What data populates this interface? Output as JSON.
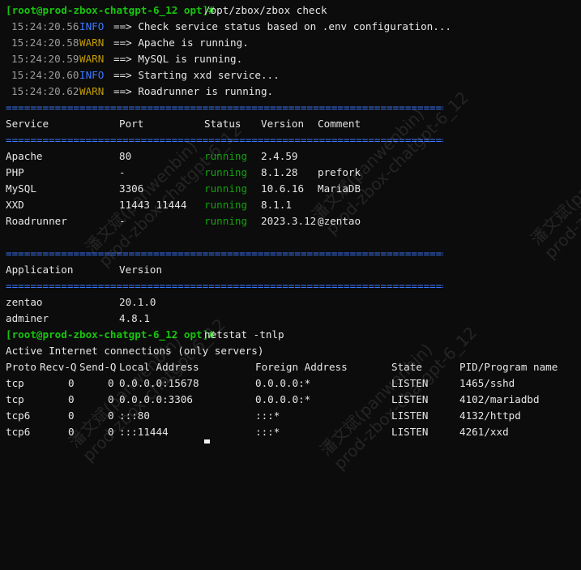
{
  "session1": {
    "prompt": "[root@prod-zbox-chatgpt-6_12 opt]#",
    "command": "/opt/zbox/zbox check"
  },
  "logs": [
    {
      "time": "15:24:20.56",
      "level": "INFO",
      "message": "==> Check service status based on .env configuration..."
    },
    {
      "time": "15:24:20.58",
      "level": "WARN",
      "message": "==> Apache is running."
    },
    {
      "time": "15:24:20.59",
      "level": "WARN",
      "message": "==> MySQL is running."
    },
    {
      "time": "15:24:20.60",
      "level": "INFO",
      "message": "==> Starting xxd service..."
    },
    {
      "time": "15:24:20.62",
      "level": "WARN",
      "message": "==> Roadrunner is running."
    }
  ],
  "rule_text": "================================================================================",
  "services": {
    "headers": [
      "Service",
      "Port",
      "Status",
      "Version",
      "Comment"
    ],
    "rows": [
      [
        "Apache",
        "80",
        "running",
        "2.4.59",
        ""
      ],
      [
        "PHP",
        "-",
        "running",
        "8.1.28",
        "prefork"
      ],
      [
        "MySQL",
        "3306",
        "running",
        "10.6.16",
        "MariaDB"
      ],
      [
        "XXD",
        "11443 11444",
        "running",
        "8.1.1",
        ""
      ],
      [
        "Roadrunner",
        "-",
        "running",
        "2023.3.12",
        "@zentao"
      ]
    ]
  },
  "applications": {
    "headers": [
      "Application",
      "Version"
    ],
    "rows": [
      [
        "zentao",
        "20.1.0"
      ],
      [
        "adminer",
        "4.8.1"
      ]
    ]
  },
  "session2": {
    "prompt": "[root@prod-zbox-chatgpt-6_12 opt]#",
    "command": "netstat -tnlp"
  },
  "netstat": {
    "title": "Active Internet connections (only servers)",
    "headers": [
      "Proto",
      "Recv-Q",
      "Send-Q",
      "Local Address",
      "Foreign Address",
      "State",
      "PID/Program name"
    ],
    "rows": [
      [
        "tcp",
        "0",
        "0",
        "0.0.0.0:15678",
        "0.0.0.0:*",
        "LISTEN",
        "1465/sshd"
      ],
      [
        "tcp",
        "0",
        "0",
        "0.0.0.0:3306",
        "0.0.0.0:*",
        "LISTEN",
        "4102/mariadbd"
      ],
      [
        "tcp6",
        "0",
        "0",
        ":::80",
        ":::*",
        "LISTEN",
        "4132/httpd"
      ],
      [
        "tcp6",
        "0",
        "0",
        ":::11444",
        ":::*",
        "LISTEN",
        "4261/xxd"
      ]
    ]
  },
  "watermark": "潘文斌(panwenbin)\nprod-zbox-chatgpt-6_12",
  "colors": {
    "background": "#0c0c0c",
    "prompt": "#16c60c",
    "info": "#3b78ff",
    "warn": "#c19c00",
    "running": "#13a10e",
    "rule": "#3b78ff"
  }
}
